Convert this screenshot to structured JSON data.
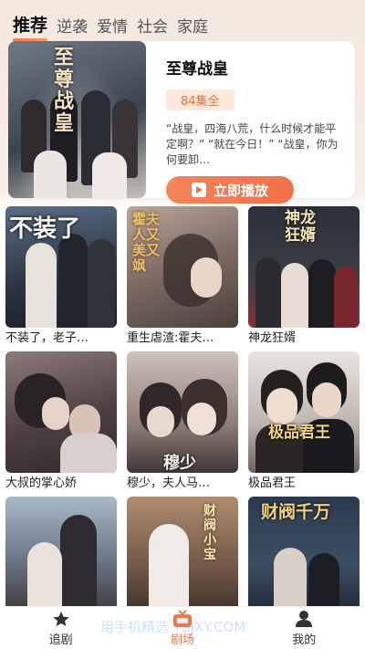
{
  "tabs": [
    "推荐",
    "逆袭",
    "爱情",
    "社会",
    "家庭"
  ],
  "hero": {
    "title": "至尊战皇",
    "episodes": "84集全",
    "description": "“战皇，四海八荒，什么时候才能平定啊？” “就在今日！” “战皇，你为何要卸…",
    "play_label": "立即播放",
    "poster_text": "至尊战皇"
  },
  "dramas": [
    {
      "title": "不装了，老子…",
      "poster_text": "不装了"
    },
    {
      "title": "重生虐渣:霍夫…",
      "poster_text": "霍夫人又美又飒"
    },
    {
      "title": "神龙狂婿",
      "poster_text": "神龙狂婿"
    },
    {
      "title": "大叔的掌心娇",
      "poster_text": ""
    },
    {
      "title": "穆少，夫人马…",
      "poster_text": "穆少"
    },
    {
      "title": "极品君王",
      "poster_text": "极品君王"
    },
    {
      "title": "",
      "poster_text": ""
    },
    {
      "title": "",
      "poster_text": "财阀小宝"
    },
    {
      "title": "",
      "poster_text": "财阀千万"
    }
  ],
  "nav": [
    {
      "label": "追剧",
      "icon": "star-icon"
    },
    {
      "label": "剧场",
      "icon": "tv-icon"
    },
    {
      "label": "我的",
      "icon": "user-icon"
    }
  ],
  "watermark": "用手机精选 YSJXY.COM",
  "colors": {
    "accent": "#f07a45",
    "badge_bg": "#fde9dc"
  }
}
